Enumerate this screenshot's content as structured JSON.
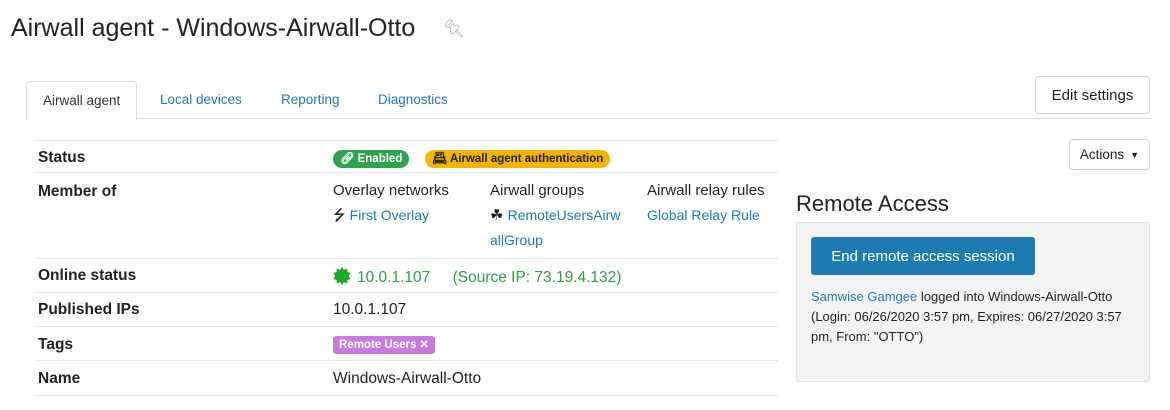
{
  "page": {
    "title": "Airwall agent - Windows-Airwall-Otto"
  },
  "tabs": [
    {
      "label": "Airwall agent"
    },
    {
      "label": "Local devices"
    },
    {
      "label": "Reporting"
    },
    {
      "label": "Diagnostics"
    }
  ],
  "buttons": {
    "edit_settings": "Edit settings",
    "actions": "Actions"
  },
  "properties": {
    "status": {
      "label": "Status",
      "badge_enabled": "Enabled",
      "badge_auth": "Airwall agent authentication"
    },
    "member_of": {
      "label": "Member of",
      "overlay_heading": "Overlay networks",
      "overlay_link": "First Overlay",
      "groups_heading": "Airwall groups",
      "groups_link": "RemoteUsersAirwallGroup",
      "relay_heading": "Airwall relay rules",
      "relay_link": "Global Relay Rule"
    },
    "online_status": {
      "label": "Online status",
      "ip": "10.0.1.107",
      "source": "(Source IP: 73.19.4.132)"
    },
    "published_ips": {
      "label": "Published IPs",
      "value": "10.0.1.107"
    },
    "tags": {
      "label": "Tags",
      "tag": "Remote Users"
    },
    "name": {
      "label": "Name",
      "value": "Windows-Airwall-Otto"
    }
  },
  "remote_access": {
    "title": "Remote Access",
    "end_button": "End remote access session",
    "user_link": "Samwise Gamgee",
    "logged_into": "logged into Windows-Airwall-Otto",
    "details": "(Login: 06/26/2020 3:57 pm, Expires: 06/27/2020 3:57 pm, From: \"OTTO\")"
  },
  "colors": {
    "link": "#1a7ab8",
    "enabled_badge": "#2ea44f",
    "auth_badge": "#f4b400",
    "tag_badge": "#c77be0",
    "online_green": "#2e9e3e",
    "primary_button": "#1d7cb1"
  }
}
